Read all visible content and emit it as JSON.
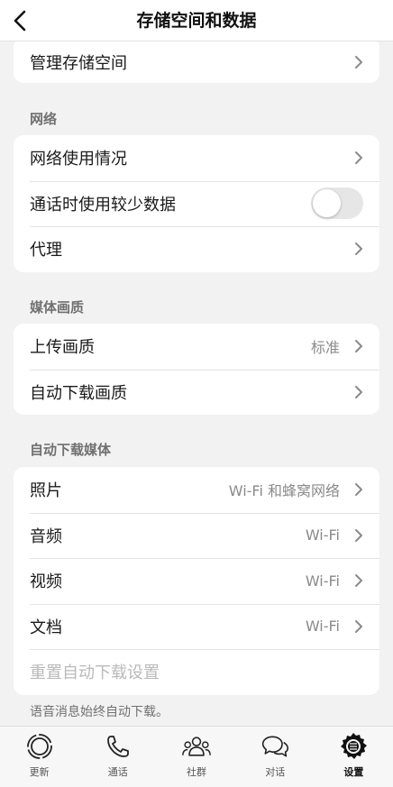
{
  "header": {
    "title": "存储空间和数据"
  },
  "storage": {
    "manage_label": "管理存储空间"
  },
  "network": {
    "section_title": "网络",
    "items": [
      {
        "label": "网络使用情况"
      },
      {
        "label": "通话时使用较少数据",
        "toggle_on": false
      },
      {
        "label": "代理"
      }
    ]
  },
  "media_quality": {
    "section_title": "媒体画质",
    "items": [
      {
        "label": "上传画质",
        "value": "标准"
      },
      {
        "label": "自动下载画质"
      }
    ]
  },
  "auto_download": {
    "section_title": "自动下载媒体",
    "items": [
      {
        "label": "照片",
        "value": "Wi-Fi 和蜂窝网络"
      },
      {
        "label": "音频",
        "value": "Wi-Fi"
      },
      {
        "label": "视频",
        "value": "Wi-Fi"
      },
      {
        "label": "文档",
        "value": "Wi-Fi"
      }
    ],
    "reset_label": "重置自动下载设置",
    "footnote": "语音消息始终自动下载。"
  },
  "tabbar": {
    "tabs": [
      {
        "label": "更新",
        "icon": "updates-icon"
      },
      {
        "label": "通话",
        "icon": "phone-icon"
      },
      {
        "label": "社群",
        "icon": "communities-icon"
      },
      {
        "label": "对话",
        "icon": "chats-icon"
      },
      {
        "label": "设置",
        "icon": "settings-icon",
        "active": true
      }
    ]
  },
  "colors": {
    "background": "#f2f2f2",
    "card": "#ffffff",
    "secondary_text": "#8a8a8a",
    "toggle_off": "#e6e6e6"
  }
}
